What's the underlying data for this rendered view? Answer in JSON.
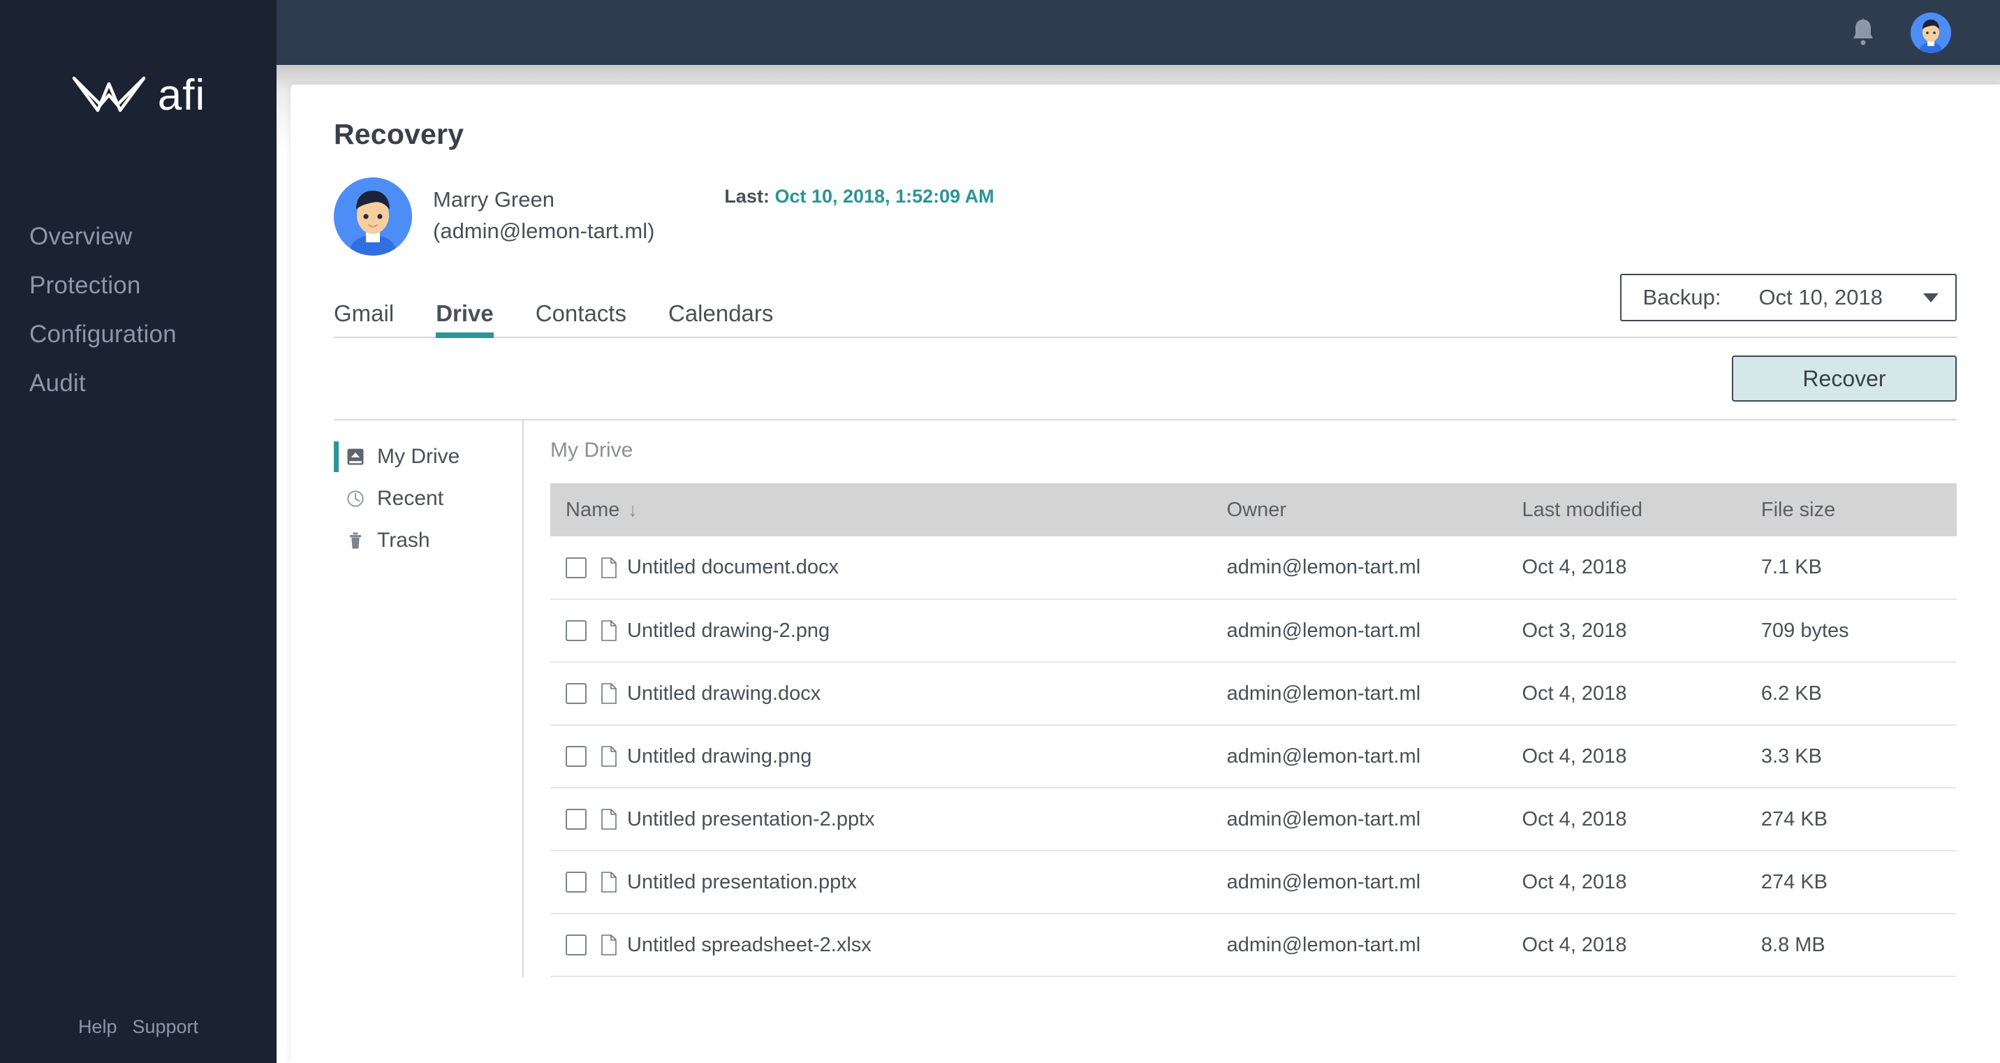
{
  "brand": {
    "name": "afi",
    "logo_icon": "crown-logo-icon"
  },
  "sidebar": {
    "items": [
      {
        "label": "Overview"
      },
      {
        "label": "Protection"
      },
      {
        "label": "Configuration"
      },
      {
        "label": "Audit"
      }
    ],
    "footer": {
      "help": "Help",
      "support": "Support"
    }
  },
  "topbar": {
    "notifications_icon": "bell-icon",
    "avatar_icon": "user-avatar"
  },
  "page": {
    "title": "Recovery",
    "user": {
      "name": "Marry Green",
      "email": "(admin@lemon-tart.ml)",
      "avatar_icon": "user-avatar"
    },
    "last": {
      "label": "Last:",
      "value": "Oct 10, 2018, 1:52:09 AM"
    }
  },
  "tabs": [
    {
      "label": "Gmail",
      "active": false
    },
    {
      "label": "Drive",
      "active": true
    },
    {
      "label": "Contacts",
      "active": false
    },
    {
      "label": "Calendars",
      "active": false
    }
  ],
  "backup": {
    "label": "Backup:",
    "value": "Oct 10, 2018",
    "caret_icon": "chevron-down-icon"
  },
  "actions": {
    "recover_label": "Recover"
  },
  "tree": [
    {
      "label": "My Drive",
      "icon": "drive-icon",
      "active": true
    },
    {
      "label": "Recent",
      "icon": "clock-icon",
      "active": false
    },
    {
      "label": "Trash",
      "icon": "trash-icon",
      "active": false
    }
  ],
  "files_panel": {
    "breadcrumb": "My Drive",
    "columns": {
      "name": "Name",
      "owner": "Owner",
      "modified": "Last modified",
      "size": "File size"
    },
    "sort": {
      "column": "Name",
      "direction": "desc",
      "icon": "arrow-down-icon"
    },
    "rows": [
      {
        "name": "Untitled document.docx",
        "owner": "admin@lemon-tart.ml",
        "modified": "Oct 4, 2018",
        "size": "7.1 KB"
      },
      {
        "name": "Untitled drawing-2.png",
        "owner": "admin@lemon-tart.ml",
        "modified": "Oct 3, 2018",
        "size": "709 bytes"
      },
      {
        "name": "Untitled drawing.docx",
        "owner": "admin@lemon-tart.ml",
        "modified": "Oct 4, 2018",
        "size": "6.2 KB"
      },
      {
        "name": "Untitled drawing.png",
        "owner": "admin@lemon-tart.ml",
        "modified": "Oct 4, 2018",
        "size": "3.3 KB"
      },
      {
        "name": "Untitled presentation-2.pptx",
        "owner": "admin@lemon-tart.ml",
        "modified": "Oct 4, 2018",
        "size": "274 KB"
      },
      {
        "name": "Untitled presentation.pptx",
        "owner": "admin@lemon-tart.ml",
        "modified": "Oct 4, 2018",
        "size": "274 KB"
      },
      {
        "name": "Untitled spreadsheet-2.xlsx",
        "owner": "admin@lemon-tart.ml",
        "modified": "Oct 4, 2018",
        "size": "8.8 MB"
      }
    ]
  },
  "colors": {
    "sidebar_bg": "#1b2231",
    "topbar_bg": "#2e3c4f",
    "accent_teal": "#2e9498",
    "recover_bg": "#d4e8e8",
    "avatar_blue": "#4d8df6",
    "table_header_bg": "#d4d4d4"
  }
}
